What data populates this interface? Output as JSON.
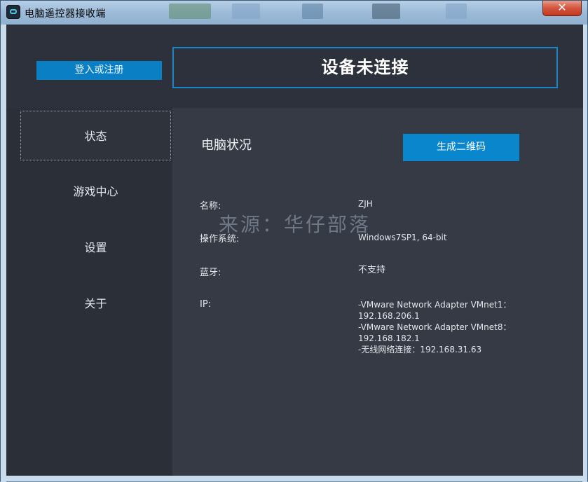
{
  "window": {
    "title": "电脑遥控器接收端",
    "close_glyph": "✕"
  },
  "header": {
    "login_label": "登入或注册",
    "status_text": "设备未连接"
  },
  "sidebar": {
    "items": [
      {
        "label": "状态",
        "active": true
      },
      {
        "label": "游戏中心",
        "active": false
      },
      {
        "label": "设置",
        "active": false
      },
      {
        "label": "关于",
        "active": false
      }
    ]
  },
  "main": {
    "section_title": "电脑状况",
    "qr_button": "生成二维码",
    "rows": {
      "name": {
        "label": "名称:",
        "value": "ZJH"
      },
      "os": {
        "label": "操作系统:",
        "value": "Windows7SP1, 64-bit"
      },
      "bluetooth": {
        "label": "蓝牙:",
        "value": "不支持"
      },
      "ip": {
        "label": "IP:",
        "lines": [
          "-VMware Network Adapter VMnet1：",
          "192.168.206.1",
          "-VMware Network Adapter VMnet8：",
          "192.168.182.1",
          "-无线网络连接：192.168.31.63"
        ]
      }
    }
  },
  "watermark": "来源：华仔部落",
  "colors": {
    "accent": "#0a86cd",
    "panel_dark": "#2a2f38",
    "panel_main": "#353a44"
  }
}
